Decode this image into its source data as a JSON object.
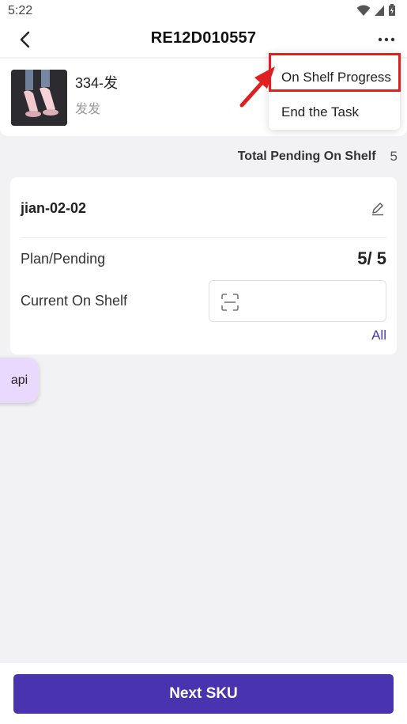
{
  "status_bar": {
    "time": "5:22"
  },
  "app_bar": {
    "title": "RE12D010557"
  },
  "product": {
    "name": "334-发",
    "subtitle": "发发"
  },
  "summary": {
    "pending_label": "Total Pending On Shelf",
    "pending_count": "5"
  },
  "location": {
    "code": "jian-02-02",
    "plan_label": "Plan/Pending",
    "plan_value": "5/ 5",
    "shelf_label": "Current On Shelf",
    "shelf_input_value": "",
    "all_link": "All"
  },
  "fab": {
    "label": "api"
  },
  "menu": {
    "items": [
      {
        "label": "On Shelf Progress"
      },
      {
        "label": "End the Task"
      }
    ]
  },
  "bottom": {
    "next_label": "Next SKU"
  },
  "icons": [
    "back-arrow-icon",
    "more-icon",
    "edit-icon",
    "scan-icon",
    "wifi-icon",
    "signal-icon",
    "battery-icon"
  ],
  "colors": {
    "primary": "#4a33ae",
    "link": "#4a3aad",
    "highlight": "#e02020",
    "fab": "#ead9ff"
  }
}
